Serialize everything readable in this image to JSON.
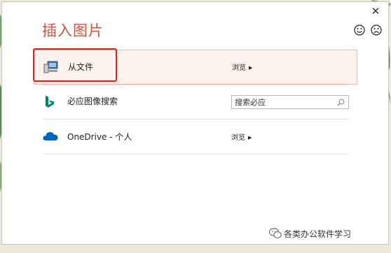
{
  "dialog": {
    "title": "插入图片",
    "close_glyph": "✕",
    "smile_icon": "smile-icon",
    "frown_icon": "frown-icon"
  },
  "rows": [
    {
      "icon": "computer-icon",
      "label": "从文件",
      "action": "浏览"
    },
    {
      "icon": "bing-icon",
      "label": "必应图像搜索",
      "search_placeholder": "搜索必应"
    },
    {
      "icon": "onedrive-icon",
      "label": "OneDrive - 个人",
      "action": "浏览"
    }
  ],
  "watermark": {
    "text": "各类办公软件学习"
  },
  "colors": {
    "title": "#c5573f",
    "selected_bg": "#fcf2ee",
    "selected_border": "#efb7a6",
    "annotation": "#e52019",
    "bing": "#008373",
    "onedrive": "#0364b8"
  }
}
